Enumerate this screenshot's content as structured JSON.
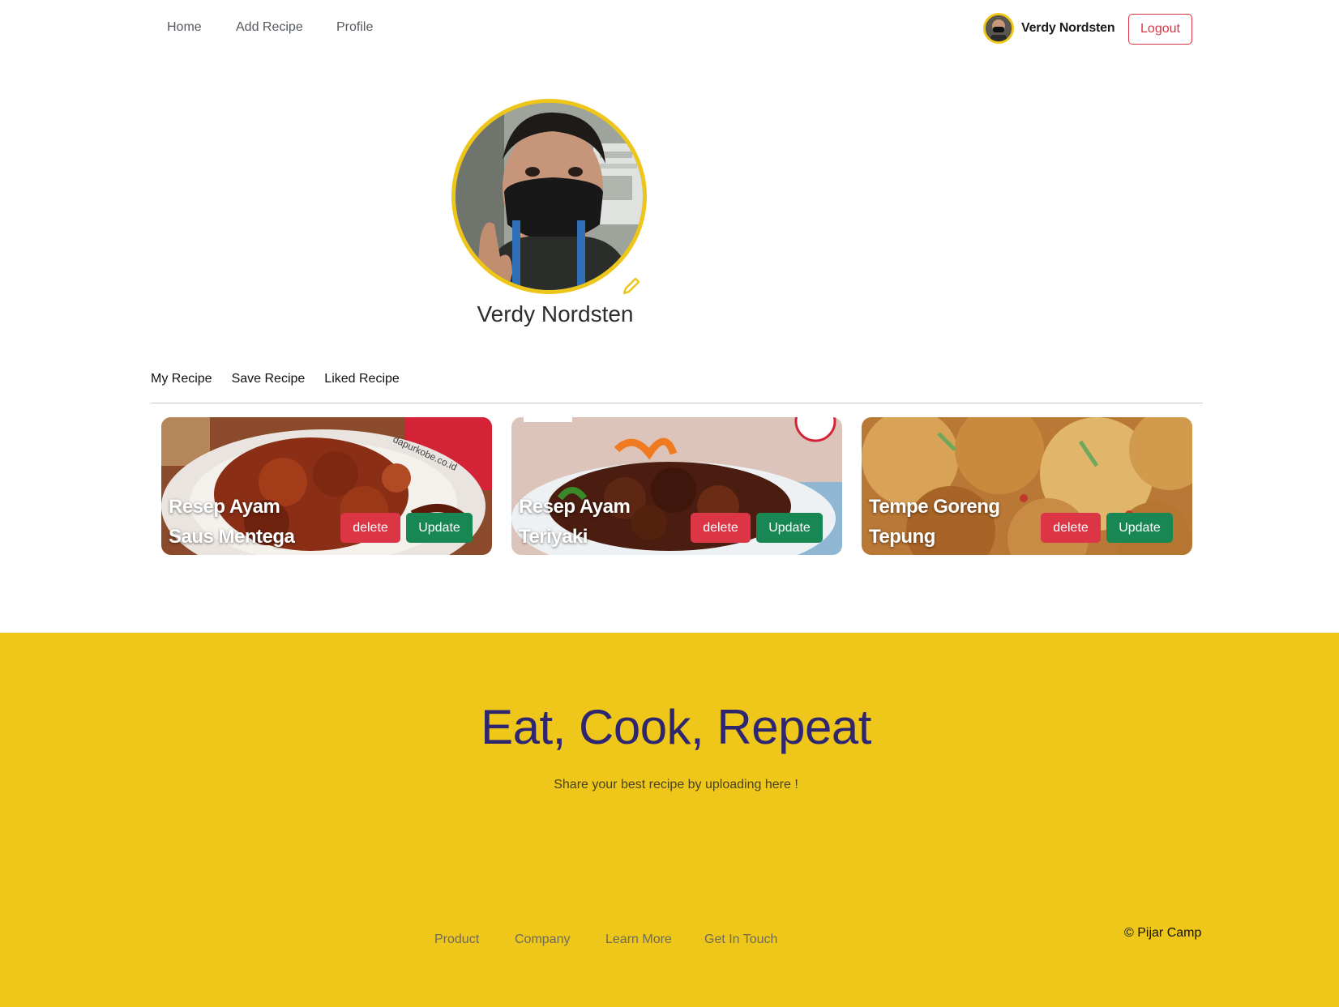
{
  "nav": {
    "links": [
      "Home",
      "Add Recipe",
      "Profile"
    ],
    "username": "Verdy Nordsten",
    "logout_label": "Logout"
  },
  "profile": {
    "name": "Verdy Nordsten"
  },
  "tabs": [
    "My Recipe",
    "Save Recipe",
    "Liked Recipe"
  ],
  "recipes": [
    {
      "title": "Resep Ayam Saus Mentega",
      "delete_label": "delete",
      "update_label": "Update"
    },
    {
      "title": "Resep Ayam Teriyaki",
      "delete_label": "delete",
      "update_label": "Update"
    },
    {
      "title": "Tempe Goreng Tepung",
      "delete_label": "delete",
      "update_label": "Update"
    }
  ],
  "footer": {
    "title": "Eat, Cook, Repeat",
    "subtitle": "Share your best recipe by uploading here !",
    "links": [
      "Product",
      "Company",
      "Learn More",
      "Get In Touch"
    ],
    "copyright": "© Pijar Camp"
  },
  "colors": {
    "accent_yellow": "#EEC61A",
    "delete_red": "#dc3545",
    "update_green": "#198754",
    "footer_title": "#2e266f"
  },
  "icons": {
    "edit": "pencil-icon"
  }
}
